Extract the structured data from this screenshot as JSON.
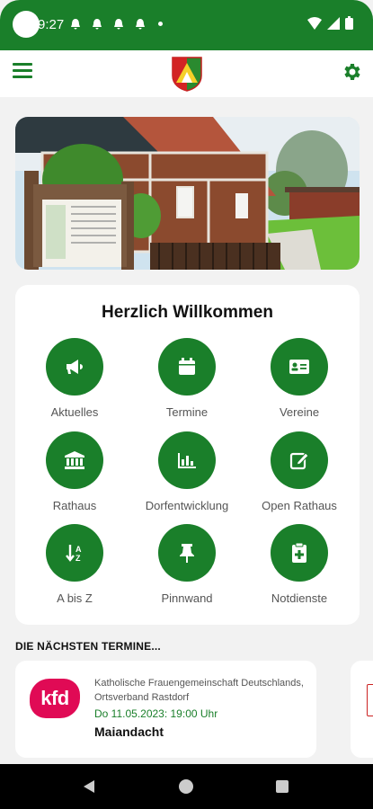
{
  "status": {
    "time": "9:27",
    "notification_icons": [
      "bell-icon",
      "bell-icon",
      "bell-icon",
      "bell-icon"
    ]
  },
  "header": {
    "menu_icon": "hamburger-icon",
    "logo": "coat-of-arms",
    "settings_icon": "gear-icon"
  },
  "welcome": {
    "title": "Herzlich Willkommen",
    "tiles": [
      {
        "label": "Aktuelles",
        "icon": "megaphone-icon"
      },
      {
        "label": "Termine",
        "icon": "calendar-icon"
      },
      {
        "label": "Vereine",
        "icon": "id-card-icon"
      },
      {
        "label": "Rathaus",
        "icon": "town-hall-icon"
      },
      {
        "label": "Dorfentwicklung",
        "icon": "bar-chart-icon"
      },
      {
        "label": "Open Rathaus",
        "icon": "edit-icon"
      },
      {
        "label": "A bis Z",
        "icon": "sort-az-icon"
      },
      {
        "label": "Pinnwand",
        "icon": "pin-icon"
      },
      {
        "label": "Notdienste",
        "icon": "medical-clipboard-icon"
      }
    ]
  },
  "events": {
    "section_title": "DIE NÄCHSTEN TERMINE...",
    "items": [
      {
        "logo_text": "kfd",
        "organizer": "Katholische Frauengemeinschaft Deutschlands, Ortsverband Rastdorf",
        "date": "Do 11.05.2023: 19:00 Uhr",
        "title": "Maiandacht"
      }
    ]
  },
  "colors": {
    "primary": "#1a7f2a",
    "kfd": "#e00a55"
  }
}
